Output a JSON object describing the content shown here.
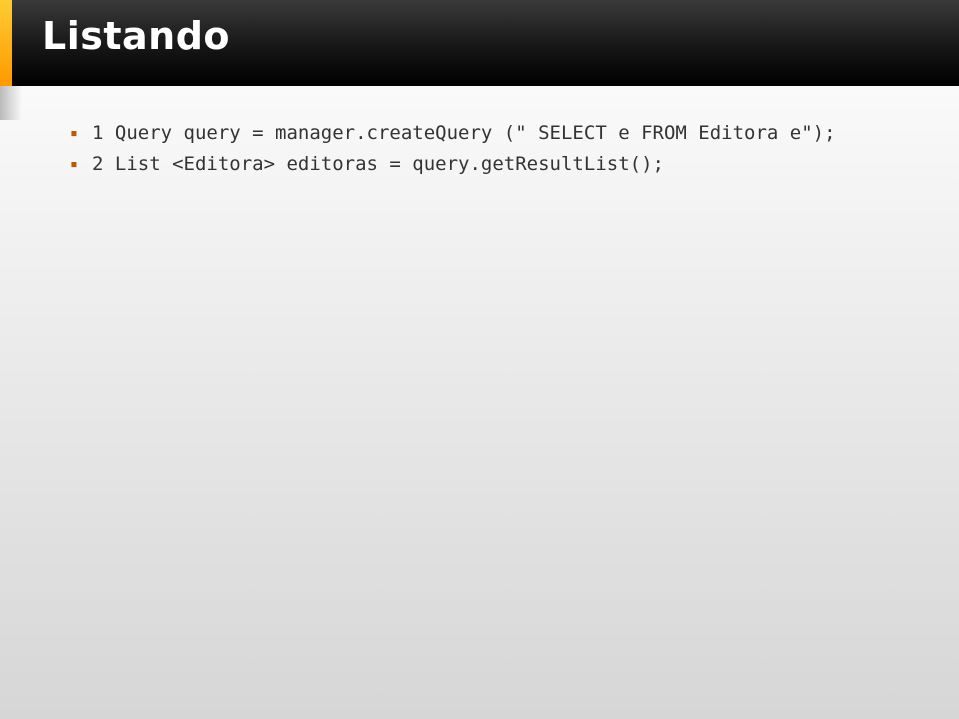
{
  "slide": {
    "title": "Listando",
    "lines": [
      "1 Query query = manager.createQuery (\" SELECT e FROM Editora e\");",
      "2 List <Editora> editoras = query.getResultList();"
    ]
  }
}
